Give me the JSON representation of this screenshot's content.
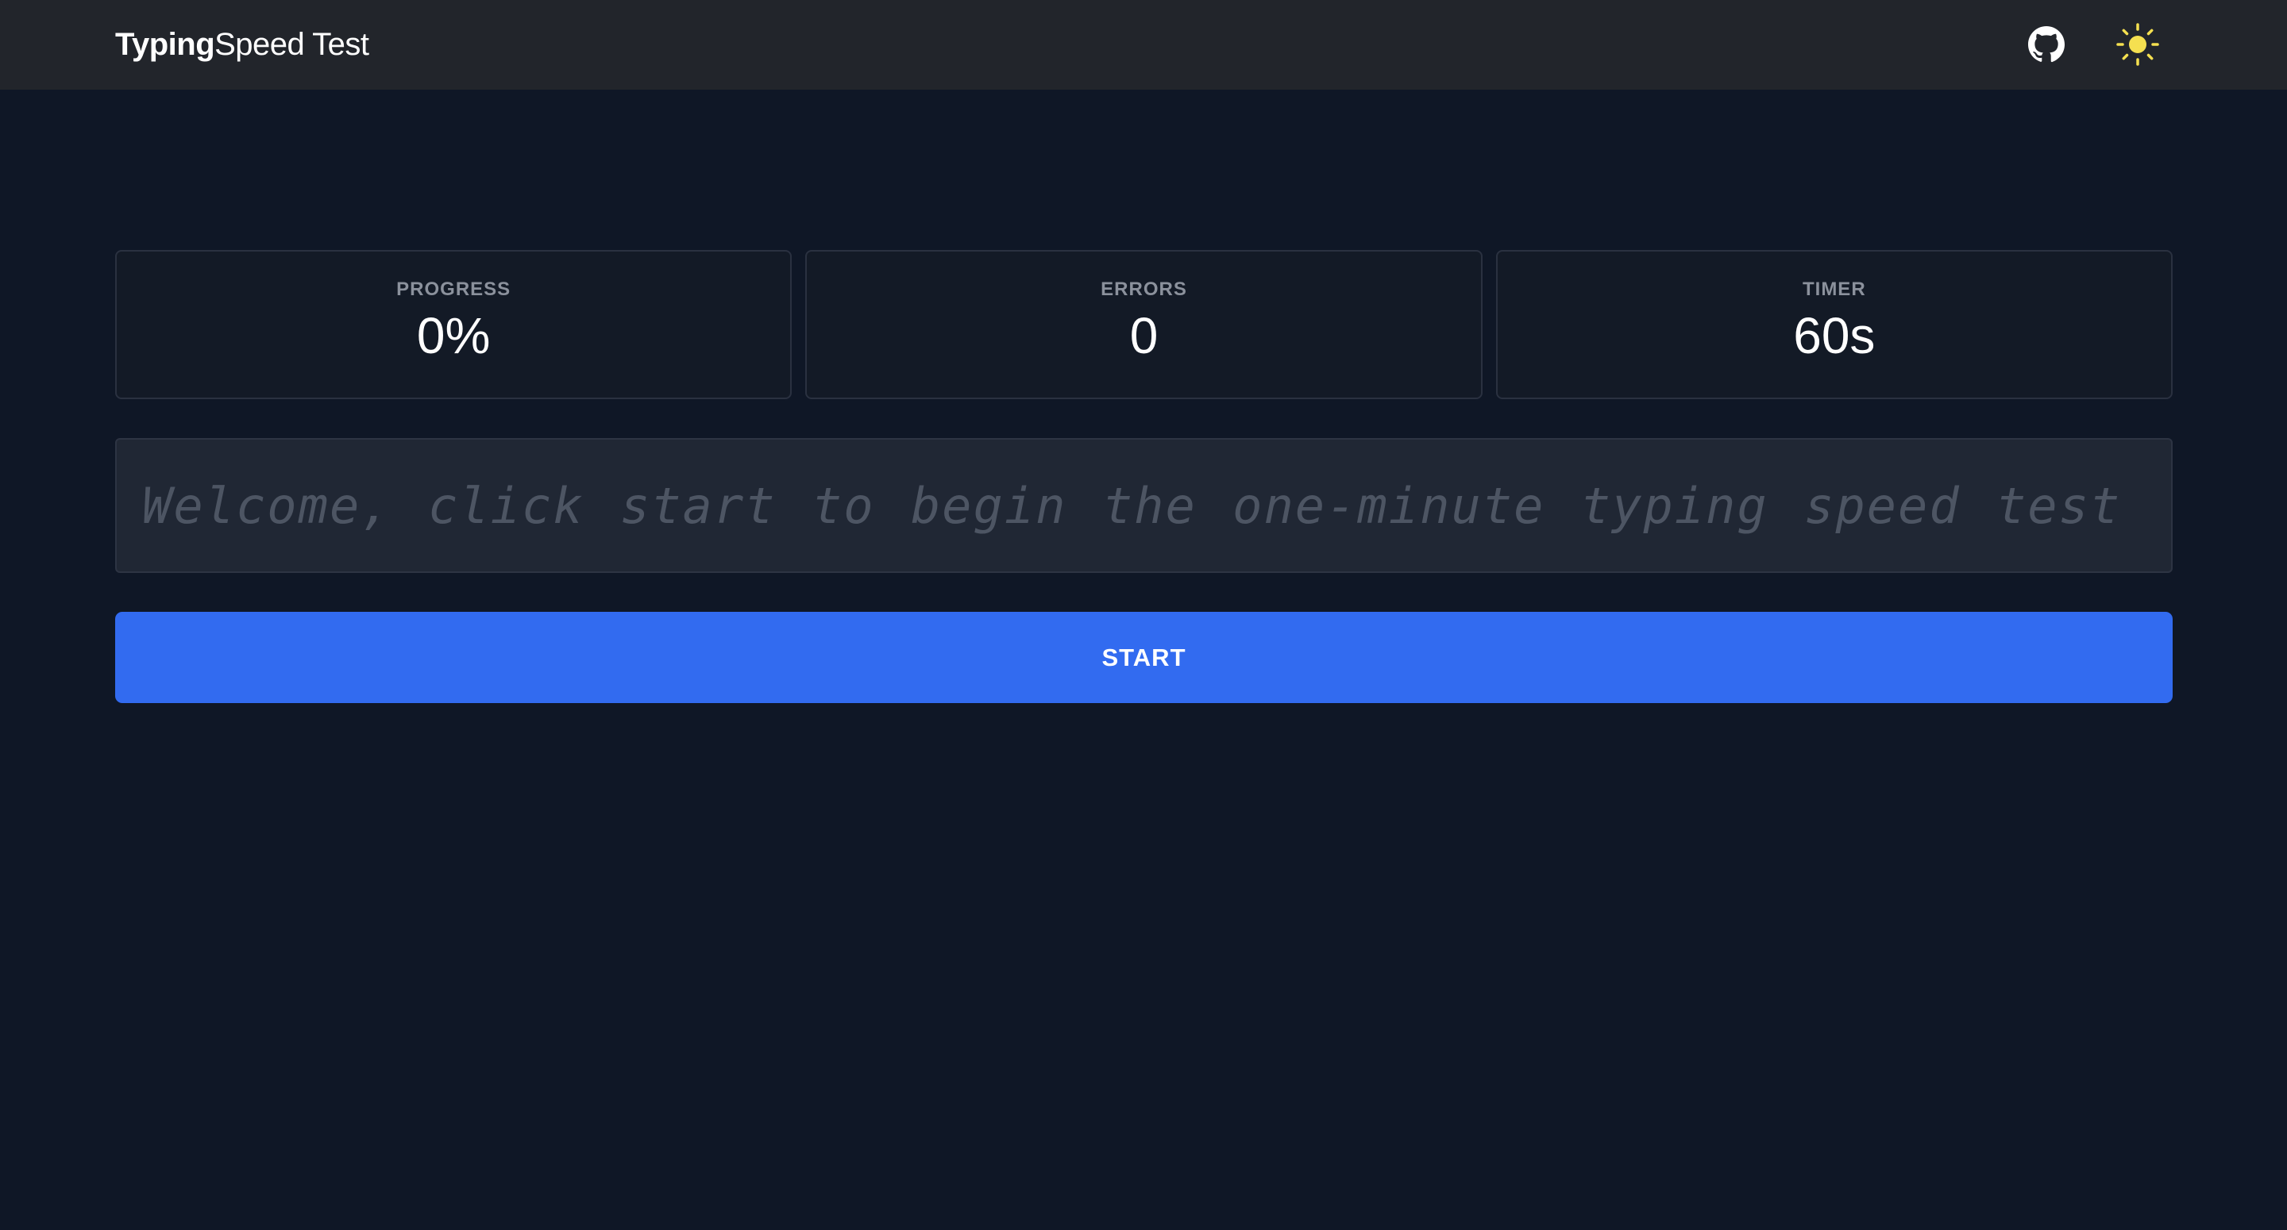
{
  "header": {
    "brand_bold": "Typing",
    "brand_normal": "Speed Test",
    "github_icon": "github-icon",
    "theme_icon": "sun-icon"
  },
  "stats": [
    {
      "label": "PROGRESS",
      "value": "0%"
    },
    {
      "label": "ERRORS",
      "value": "0"
    },
    {
      "label": "TIMER",
      "value": "60s"
    }
  ],
  "typing_area": {
    "placeholder": "Welcome, click start to begin the one-minute typing speed test"
  },
  "start_button": {
    "label": "START"
  },
  "colors": {
    "background": "#0f1726",
    "header": "#22252b",
    "accent": "#326bf0",
    "sun": "#f5e050"
  }
}
